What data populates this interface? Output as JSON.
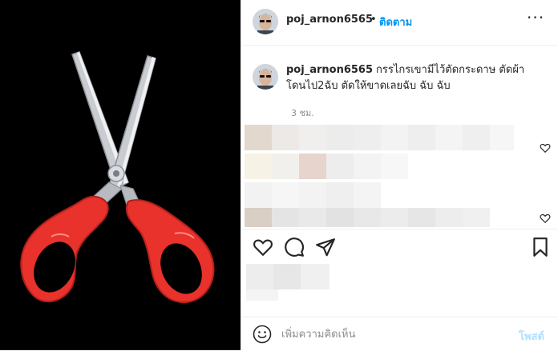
{
  "post": {
    "username": "poj_arnon6565",
    "separator": "•",
    "follow_label": "ติดตาม",
    "more_label": "···",
    "caption": "กรรไกรเขามีไว้ตัดกระดาษ ตัดผ้า โดนไป2ฉับ ตัดให้ขาดเลยฉับ ฉับ ฉับ",
    "time_ago": "3 ชม."
  },
  "comment_box": {
    "placeholder": "เพิ่มความคิดเห็น",
    "post_label": "โพสต์"
  },
  "icons": {
    "like": "heart-icon",
    "comment": "comment-icon",
    "share": "share-icon",
    "save": "bookmark-icon",
    "emoji": "emoji-icon",
    "comment_like": "heart-icon"
  },
  "colors": {
    "link": "#0095f6",
    "post_disabled": "#b2dffc",
    "scissor_handle": "#e8322b",
    "media_bg": "#000000"
  }
}
